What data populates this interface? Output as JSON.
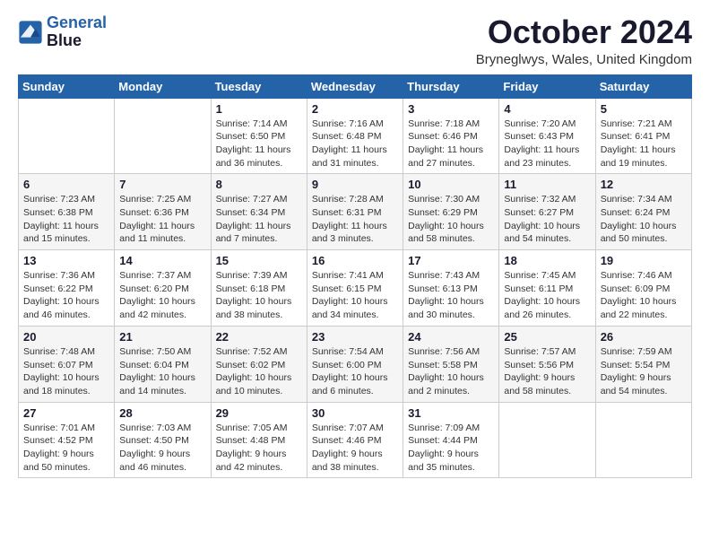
{
  "logo": {
    "line1": "General",
    "line2": "Blue"
  },
  "title": "October 2024",
  "location": "Bryneglwys, Wales, United Kingdom",
  "days_header": [
    "Sunday",
    "Monday",
    "Tuesday",
    "Wednesday",
    "Thursday",
    "Friday",
    "Saturday"
  ],
  "weeks": [
    [
      {
        "day": "",
        "info": ""
      },
      {
        "day": "",
        "info": ""
      },
      {
        "day": "1",
        "info": "Sunrise: 7:14 AM\nSunset: 6:50 PM\nDaylight: 11 hours and 36 minutes."
      },
      {
        "day": "2",
        "info": "Sunrise: 7:16 AM\nSunset: 6:48 PM\nDaylight: 11 hours and 31 minutes."
      },
      {
        "day": "3",
        "info": "Sunrise: 7:18 AM\nSunset: 6:46 PM\nDaylight: 11 hours and 27 minutes."
      },
      {
        "day": "4",
        "info": "Sunrise: 7:20 AM\nSunset: 6:43 PM\nDaylight: 11 hours and 23 minutes."
      },
      {
        "day": "5",
        "info": "Sunrise: 7:21 AM\nSunset: 6:41 PM\nDaylight: 11 hours and 19 minutes."
      }
    ],
    [
      {
        "day": "6",
        "info": "Sunrise: 7:23 AM\nSunset: 6:38 PM\nDaylight: 11 hours and 15 minutes."
      },
      {
        "day": "7",
        "info": "Sunrise: 7:25 AM\nSunset: 6:36 PM\nDaylight: 11 hours and 11 minutes."
      },
      {
        "day": "8",
        "info": "Sunrise: 7:27 AM\nSunset: 6:34 PM\nDaylight: 11 hours and 7 minutes."
      },
      {
        "day": "9",
        "info": "Sunrise: 7:28 AM\nSunset: 6:31 PM\nDaylight: 11 hours and 3 minutes."
      },
      {
        "day": "10",
        "info": "Sunrise: 7:30 AM\nSunset: 6:29 PM\nDaylight: 10 hours and 58 minutes."
      },
      {
        "day": "11",
        "info": "Sunrise: 7:32 AM\nSunset: 6:27 PM\nDaylight: 10 hours and 54 minutes."
      },
      {
        "day": "12",
        "info": "Sunrise: 7:34 AM\nSunset: 6:24 PM\nDaylight: 10 hours and 50 minutes."
      }
    ],
    [
      {
        "day": "13",
        "info": "Sunrise: 7:36 AM\nSunset: 6:22 PM\nDaylight: 10 hours and 46 minutes."
      },
      {
        "day": "14",
        "info": "Sunrise: 7:37 AM\nSunset: 6:20 PM\nDaylight: 10 hours and 42 minutes."
      },
      {
        "day": "15",
        "info": "Sunrise: 7:39 AM\nSunset: 6:18 PM\nDaylight: 10 hours and 38 minutes."
      },
      {
        "day": "16",
        "info": "Sunrise: 7:41 AM\nSunset: 6:15 PM\nDaylight: 10 hours and 34 minutes."
      },
      {
        "day": "17",
        "info": "Sunrise: 7:43 AM\nSunset: 6:13 PM\nDaylight: 10 hours and 30 minutes."
      },
      {
        "day": "18",
        "info": "Sunrise: 7:45 AM\nSunset: 6:11 PM\nDaylight: 10 hours and 26 minutes."
      },
      {
        "day": "19",
        "info": "Sunrise: 7:46 AM\nSunset: 6:09 PM\nDaylight: 10 hours and 22 minutes."
      }
    ],
    [
      {
        "day": "20",
        "info": "Sunrise: 7:48 AM\nSunset: 6:07 PM\nDaylight: 10 hours and 18 minutes."
      },
      {
        "day": "21",
        "info": "Sunrise: 7:50 AM\nSunset: 6:04 PM\nDaylight: 10 hours and 14 minutes."
      },
      {
        "day": "22",
        "info": "Sunrise: 7:52 AM\nSunset: 6:02 PM\nDaylight: 10 hours and 10 minutes."
      },
      {
        "day": "23",
        "info": "Sunrise: 7:54 AM\nSunset: 6:00 PM\nDaylight: 10 hours and 6 minutes."
      },
      {
        "day": "24",
        "info": "Sunrise: 7:56 AM\nSunset: 5:58 PM\nDaylight: 10 hours and 2 minutes."
      },
      {
        "day": "25",
        "info": "Sunrise: 7:57 AM\nSunset: 5:56 PM\nDaylight: 9 hours and 58 minutes."
      },
      {
        "day": "26",
        "info": "Sunrise: 7:59 AM\nSunset: 5:54 PM\nDaylight: 9 hours and 54 minutes."
      }
    ],
    [
      {
        "day": "27",
        "info": "Sunrise: 7:01 AM\nSunset: 4:52 PM\nDaylight: 9 hours and 50 minutes."
      },
      {
        "day": "28",
        "info": "Sunrise: 7:03 AM\nSunset: 4:50 PM\nDaylight: 9 hours and 46 minutes."
      },
      {
        "day": "29",
        "info": "Sunrise: 7:05 AM\nSunset: 4:48 PM\nDaylight: 9 hours and 42 minutes."
      },
      {
        "day": "30",
        "info": "Sunrise: 7:07 AM\nSunset: 4:46 PM\nDaylight: 9 hours and 38 minutes."
      },
      {
        "day": "31",
        "info": "Sunrise: 7:09 AM\nSunset: 4:44 PM\nDaylight: 9 hours and 35 minutes."
      },
      {
        "day": "",
        "info": ""
      },
      {
        "day": "",
        "info": ""
      }
    ]
  ]
}
